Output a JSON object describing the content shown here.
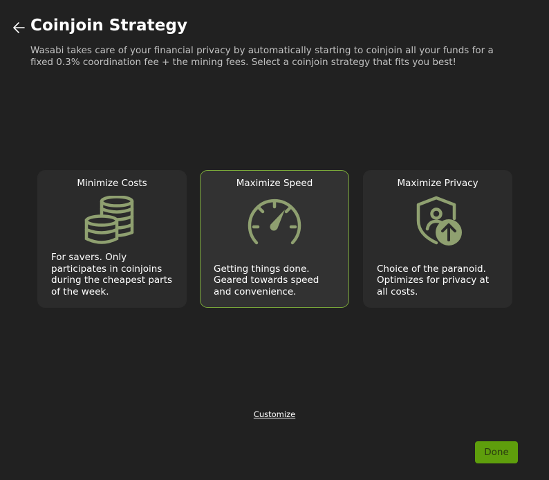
{
  "header": {
    "back_icon": "arrow-left-icon",
    "title": "Coinjoin Strategy",
    "description": "Wasabi takes care of your financial privacy by automatically starting to coinjoin all your funds for a fixed 0.3% coordination fee + the mining fees. Select a coinjoin strategy that fits you best!"
  },
  "strategies": [
    {
      "title": "Minimize Costs",
      "icon": "coin-stack-icon",
      "description": "For savers. Only participates in coinjoins during the cheapest parts of the week.",
      "selected": false
    },
    {
      "title": "Maximize Speed",
      "icon": "speedometer-icon",
      "description": "Getting things done. Geared towards speed and convenience.",
      "selected": true
    },
    {
      "title": "Maximize Privacy",
      "icon": "shield-user-icon",
      "description": "Choice of the paranoid. Optimizes for privacy at all costs.",
      "selected": false
    }
  ],
  "footer": {
    "customize_label": "Customize",
    "done_label": "Done"
  },
  "colors": {
    "background": "#212121",
    "card": "#2b2b2b",
    "card_selected": "#323232",
    "accent": "#7aa83a",
    "icon": "#8fa070",
    "button": "#5e9e0c"
  }
}
